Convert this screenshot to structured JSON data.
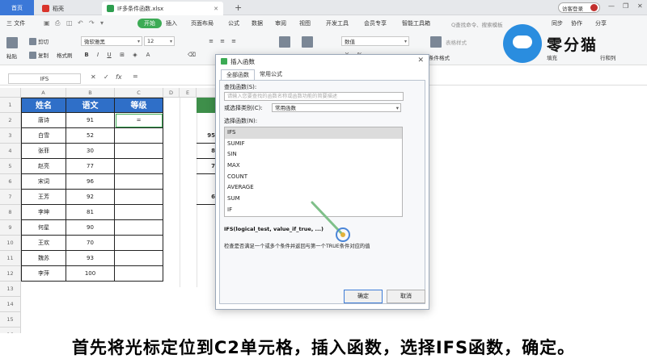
{
  "tabs": {
    "home": "首页",
    "daoke": "稻壳",
    "file": "IF多条件函数.xlsx"
  },
  "titlebar": {
    "login": "访客登录"
  },
  "menubar": {
    "file": "三 文件",
    "start": "开始",
    "items": [
      "插入",
      "页面布局",
      "公式",
      "数据",
      "审阅",
      "视图",
      "开发工具",
      "会员专享",
      "智能工具箱"
    ],
    "search_placeholder": "Q查找命令、搜索模板",
    "sync": "同步",
    "collab": "协作",
    "share": "分享"
  },
  "ribbon": {
    "paste": "粘贴",
    "cut": "剪切",
    "copy": "复制",
    "format_painter": "格式刷",
    "font_name": "微软雅黑",
    "font_size": "12",
    "number_format": "数值",
    "merge_center": "合并居中",
    "auto_wrap": "自动换行",
    "table_style": "表格样式",
    "cond_format": "条件格式",
    "sum": "求和",
    "fill": "填充",
    "row_col": "行和列"
  },
  "formula_bar": {
    "cell_ref": "IFS",
    "formula": "="
  },
  "sheet": {
    "columns": [
      "A",
      "B",
      "C",
      "D",
      "E"
    ],
    "rows": [
      "1",
      "2",
      "3",
      "4",
      "5",
      "6",
      "7",
      "8",
      "9",
      "10",
      "11",
      "12",
      "13",
      "14",
      "15",
      "16"
    ],
    "header": [
      "姓名",
      "语文",
      "等级"
    ],
    "data": [
      [
        "唐诗",
        "91",
        "="
      ],
      [
        "白雪",
        "52",
        ""
      ],
      [
        "张菲",
        "30",
        ""
      ],
      [
        "赵亮",
        "77",
        ""
      ],
      [
        "宋词",
        "96",
        ""
      ],
      [
        "王芳",
        "92",
        ""
      ],
      [
        "李坤",
        "81",
        ""
      ],
      [
        "何星",
        "90",
        ""
      ],
      [
        "王欢",
        "70",
        ""
      ],
      [
        "魏苏",
        "93",
        ""
      ],
      [
        "李萍",
        "100",
        ""
      ]
    ],
    "partial_values": [
      "95",
      "8",
      "7",
      "6"
    ]
  },
  "dialog": {
    "title": "插入函数",
    "tabs": [
      "全部函数",
      "常用公式"
    ],
    "search_label": "查找函数(S):",
    "search_placeholder": "请输入您要查找的函数名称或函数功能的简要描述",
    "category_label": "或选择类别(C):",
    "category_value": "常用函数",
    "select_label": "选择函数(N):",
    "functions": [
      "IFS",
      "SUMIF",
      "SIN",
      "MAX",
      "COUNT",
      "AVERAGE",
      "SUM",
      "IF"
    ],
    "signature": "IFS(logical_test, value_if_true, ...)",
    "description": "检查是否满足一个或多个条件并返回与第一个TRUE条件对应的值",
    "ok": "确定",
    "cancel": "取消"
  },
  "caption": "首先将光标定位到C2单元格，插入函数，选择IFS函数，确定。",
  "brand": "零分猫",
  "colors": {
    "header_blue": "#2f6fc8",
    "accent_green": "#3cab55",
    "partial_green": "#3e8f4a"
  }
}
